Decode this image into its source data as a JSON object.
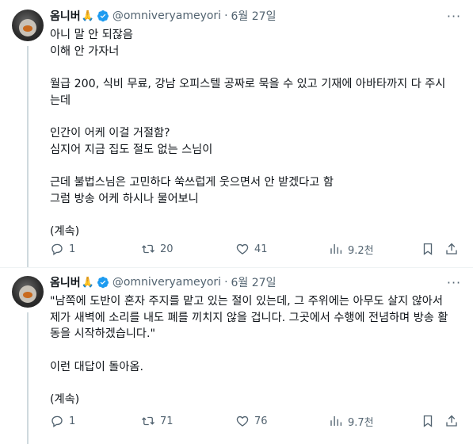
{
  "tweets": [
    {
      "author": {
        "name": "옴니버",
        "emoji": "🙏",
        "handle": "@omniveryameyori",
        "date": "6월 27일"
      },
      "lines": [
        "아니 말 안 되잖음",
        "이해 안 가자너",
        "",
        "월급 200, 식비 무료, 강남 오피스텔 공짜로 묵을 수 있고 기재에 아바타까지 다 주시",
        "는데",
        "",
        "인간이 어케 이걸 거절함?",
        "심지어 지금 집도 절도 없는 스님이",
        "",
        "근데 불법스님은 고민하다 쑥쓰럽게 웃으면서 안 받겠다고 함",
        "그럼 방송 어케 하시나 물어보니",
        "",
        "(계속)"
      ],
      "stats": {
        "replies": "1",
        "retweets": "20",
        "likes": "41",
        "views": "9.2천"
      }
    },
    {
      "author": {
        "name": "옴니버",
        "emoji": "🙏",
        "handle": "@omniveryameyori",
        "date": "6월 27일"
      },
      "lines": [
        "\"남쪽에 도반이 혼자 주지를 맡고 있는 절이 있는데, 그 주위에는 아무도 살지 않아서",
        "제가 새벽에 소리를 내도 폐를 끼치지 않을 겁니다. 그곳에서 수행에 전념하며 방송 활",
        "동을 시작하겠습니다.\"",
        "",
        "이런 대답이 돌아옴.",
        "",
        "(계속)"
      ],
      "stats": {
        "replies": "1",
        "retweets": "71",
        "likes": "76",
        "views": "9.7천"
      }
    }
  ],
  "colors": {
    "text": "#0f1419",
    "muted": "#536471",
    "verified": "#1d9bf0",
    "thread_line": "#cfd9de"
  },
  "icons": [
    "more-icon",
    "verified-icon",
    "reply-icon",
    "retweet-icon",
    "like-icon",
    "views-icon",
    "bookmark-icon",
    "share-icon"
  ]
}
